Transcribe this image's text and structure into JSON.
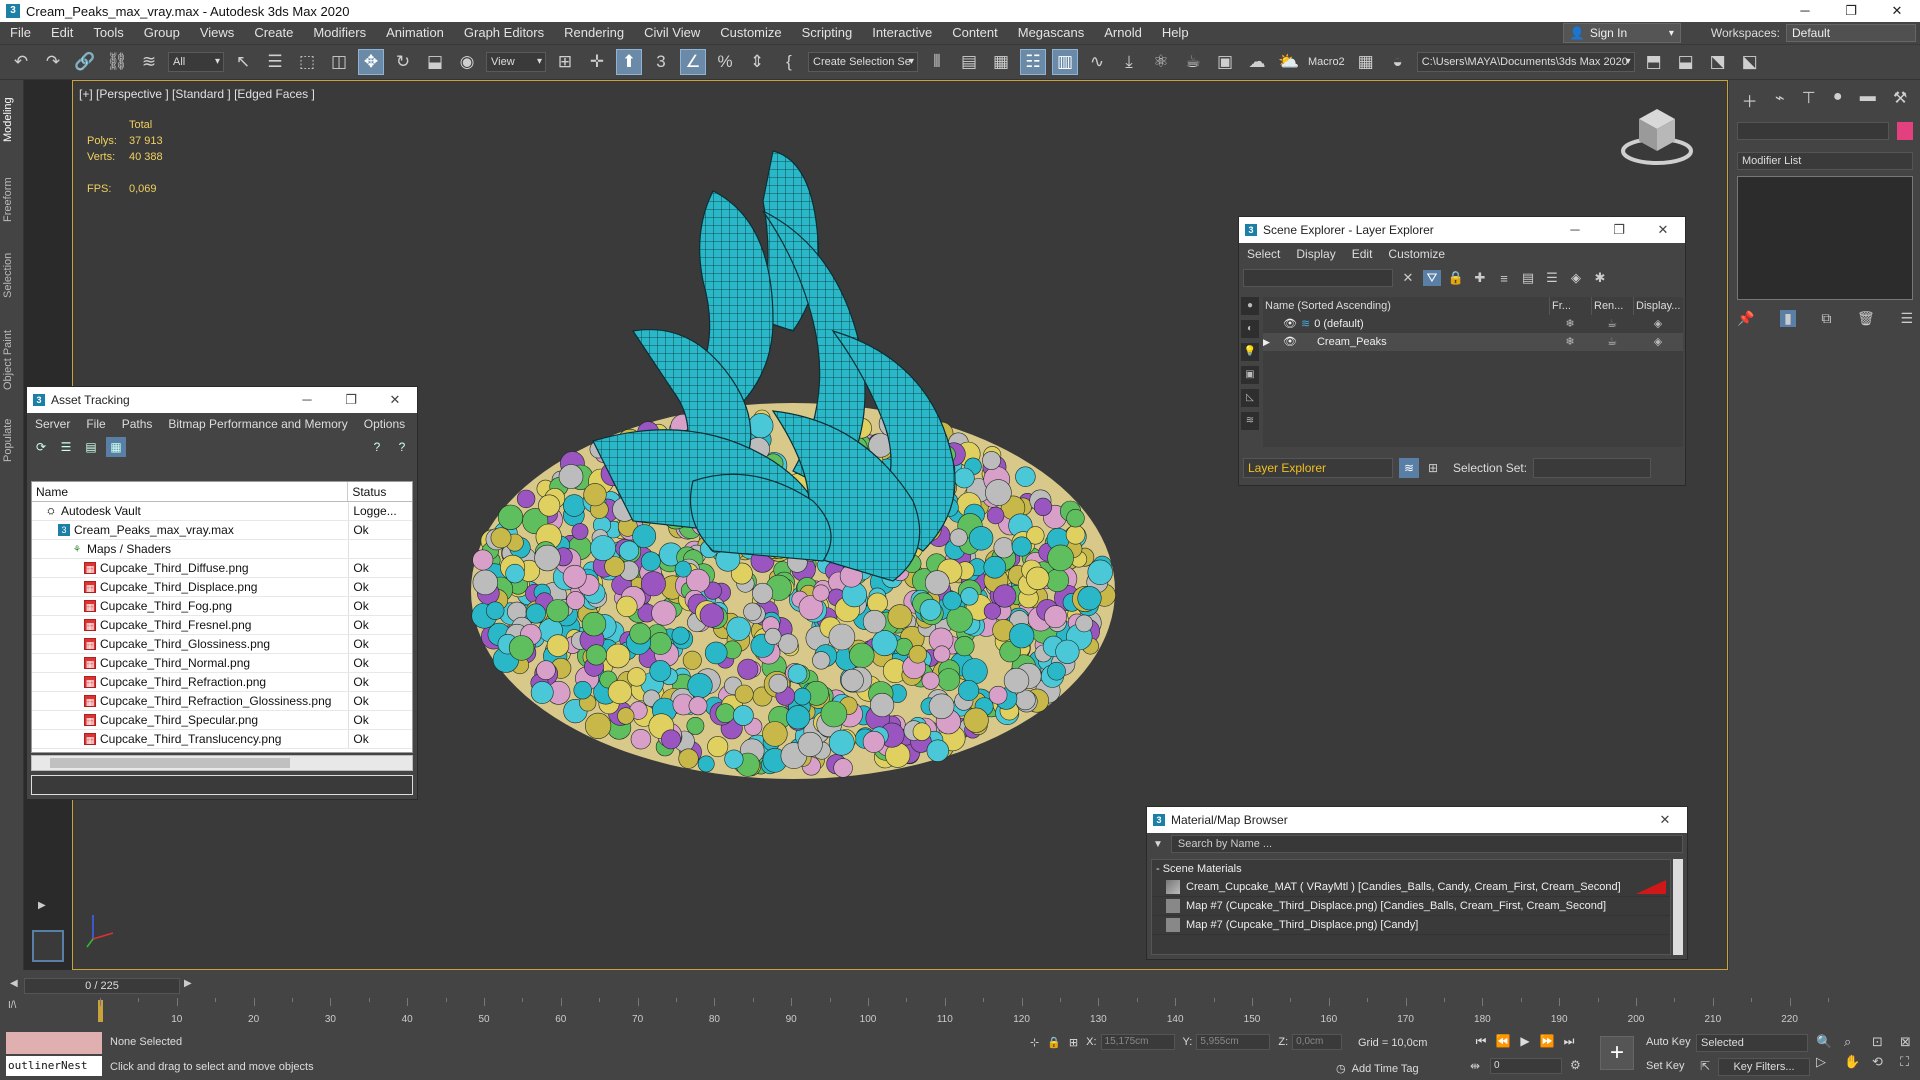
{
  "window": {
    "title": "Cream_Peaks_max_vray.max - Autodesk 3ds Max 2020",
    "minimize": "─",
    "maximize": "❐",
    "close": "✕"
  },
  "menu": [
    "File",
    "Edit",
    "Tools",
    "Group",
    "Views",
    "Create",
    "Modifiers",
    "Animation",
    "Graph Editors",
    "Rendering",
    "Civil View",
    "Customize",
    "Scripting",
    "Interactive",
    "Content",
    "Megascans",
    "Arnold",
    "Help"
  ],
  "signin": {
    "label": "Sign In"
  },
  "workspaces": {
    "label": "Workspaces:",
    "value": "Default"
  },
  "toolbar": {
    "filter": "All",
    "refcoord": "View",
    "create_selection_set": "Create Selection Se",
    "macro": "Macro2",
    "project_path": "C:\\Users\\MAYA\\Documents\\3ds Max 2020"
  },
  "left_tabs": [
    "Modeling",
    "Freeform",
    "Selection",
    "Object Paint",
    "Populate"
  ],
  "viewport": {
    "label": "[+] [Perspective ] [Standard ] [Edged Faces ]",
    "stats": {
      "total_label": "Total",
      "polys_label": "Polys:",
      "polys": "37 913",
      "verts_label": "Verts:",
      "verts": "40 388",
      "fps_label": "FPS:",
      "fps": "0,069"
    }
  },
  "asset_tracking": {
    "title": "Asset Tracking",
    "menu": [
      "Server",
      "File",
      "Paths",
      "Bitmap Performance and Memory",
      "Options"
    ],
    "columns": [
      "Name",
      "Status"
    ],
    "rows": [
      {
        "name": "Autodesk Vault",
        "status": "Logge...",
        "icon": "vault-icon",
        "indent": 1
      },
      {
        "name": "Cream_Peaks_max_vray.max",
        "status": "Ok",
        "icon": "max-file-icon",
        "indent": 2
      },
      {
        "name": "Maps / Shaders",
        "status": "",
        "icon": "folder-icon",
        "indent": 3
      },
      {
        "name": "Cupcake_Third_Diffuse.png",
        "status": "Ok",
        "icon": "png-icon",
        "indent": 4
      },
      {
        "name": "Cupcake_Third_Displace.png",
        "status": "Ok",
        "icon": "png-icon",
        "indent": 4
      },
      {
        "name": "Cupcake_Third_Fog.png",
        "status": "Ok",
        "icon": "png-icon",
        "indent": 4
      },
      {
        "name": "Cupcake_Third_Fresnel.png",
        "status": "Ok",
        "icon": "png-icon",
        "indent": 4
      },
      {
        "name": "Cupcake_Third_Glossiness.png",
        "status": "Ok",
        "icon": "png-icon",
        "indent": 4
      },
      {
        "name": "Cupcake_Third_Normal.png",
        "status": "Ok",
        "icon": "png-icon",
        "indent": 4
      },
      {
        "name": "Cupcake_Third_Refraction.png",
        "status": "Ok",
        "icon": "png-icon",
        "indent": 4
      },
      {
        "name": "Cupcake_Third_Refraction_Glossiness.png",
        "status": "Ok",
        "icon": "png-icon",
        "indent": 4
      },
      {
        "name": "Cupcake_Third_Specular.png",
        "status": "Ok",
        "icon": "png-icon",
        "indent": 4
      },
      {
        "name": "Cupcake_Third_Translucency.png",
        "status": "Ok",
        "icon": "png-icon",
        "indent": 4
      }
    ]
  },
  "scene_explorer": {
    "title": "Scene Explorer - Layer Explorer",
    "menu": [
      "Select",
      "Display",
      "Edit",
      "Customize"
    ],
    "columns": {
      "name": "Name (Sorted Ascending)",
      "freeze": "Fr...",
      "render": "Ren...",
      "display": "Display..."
    },
    "rows": [
      {
        "name": "0 (default)"
      },
      {
        "name": "Cream_Peaks"
      }
    ],
    "layer_explorer": "Layer Explorer",
    "selection_set_label": "Selection Set:"
  },
  "modifier_list": "Modifier List",
  "material_browser": {
    "title": "Material/Map Browser",
    "search_placeholder": "Search by Name ...",
    "section": "- Scene Materials",
    "rows": [
      "Cream_Cupcake_MAT ( VRayMtl ) [Candies_Balls, Candy, Cream_First, Cream_Second]",
      "Map #7 (Cupcake_Third_Displace.png) [Candies_Balls, Cream_First, Cream_Second]",
      "Map #7 (Cupcake_Third_Displace.png) [Candy]"
    ]
  },
  "timeline": {
    "slider": "0 / 225",
    "ticks": [
      "10",
      "20",
      "30",
      "40",
      "50",
      "60",
      "70",
      "80",
      "90",
      "100",
      "110",
      "120",
      "130",
      "140",
      "150",
      "160",
      "170",
      "180",
      "190",
      "200",
      "210",
      "220"
    ]
  },
  "statusbar": {
    "script_text": "outlinerNest",
    "selection": "None Selected",
    "prompt": "Click and drag to select and move objects",
    "x_label": "X:",
    "x": "15,175cm",
    "y_label": "Y:",
    "y": "5,955cm",
    "z_label": "Z:",
    "z": "0,0cm",
    "grid": "Grid = 10,0cm",
    "add_time_tag": "Add Time Tag",
    "auto_key": "Auto Key",
    "set_key": "Set Key",
    "selected": "Selected",
    "key_filters": "Key Filters...",
    "frame": "0"
  },
  "colors": {
    "accent": "#5a7fa6",
    "viewport_border": "#c8a23a",
    "stats_text": "#f0d060",
    "mesh_cyan": "#2ab8c8",
    "object_color": "#e2407f"
  }
}
